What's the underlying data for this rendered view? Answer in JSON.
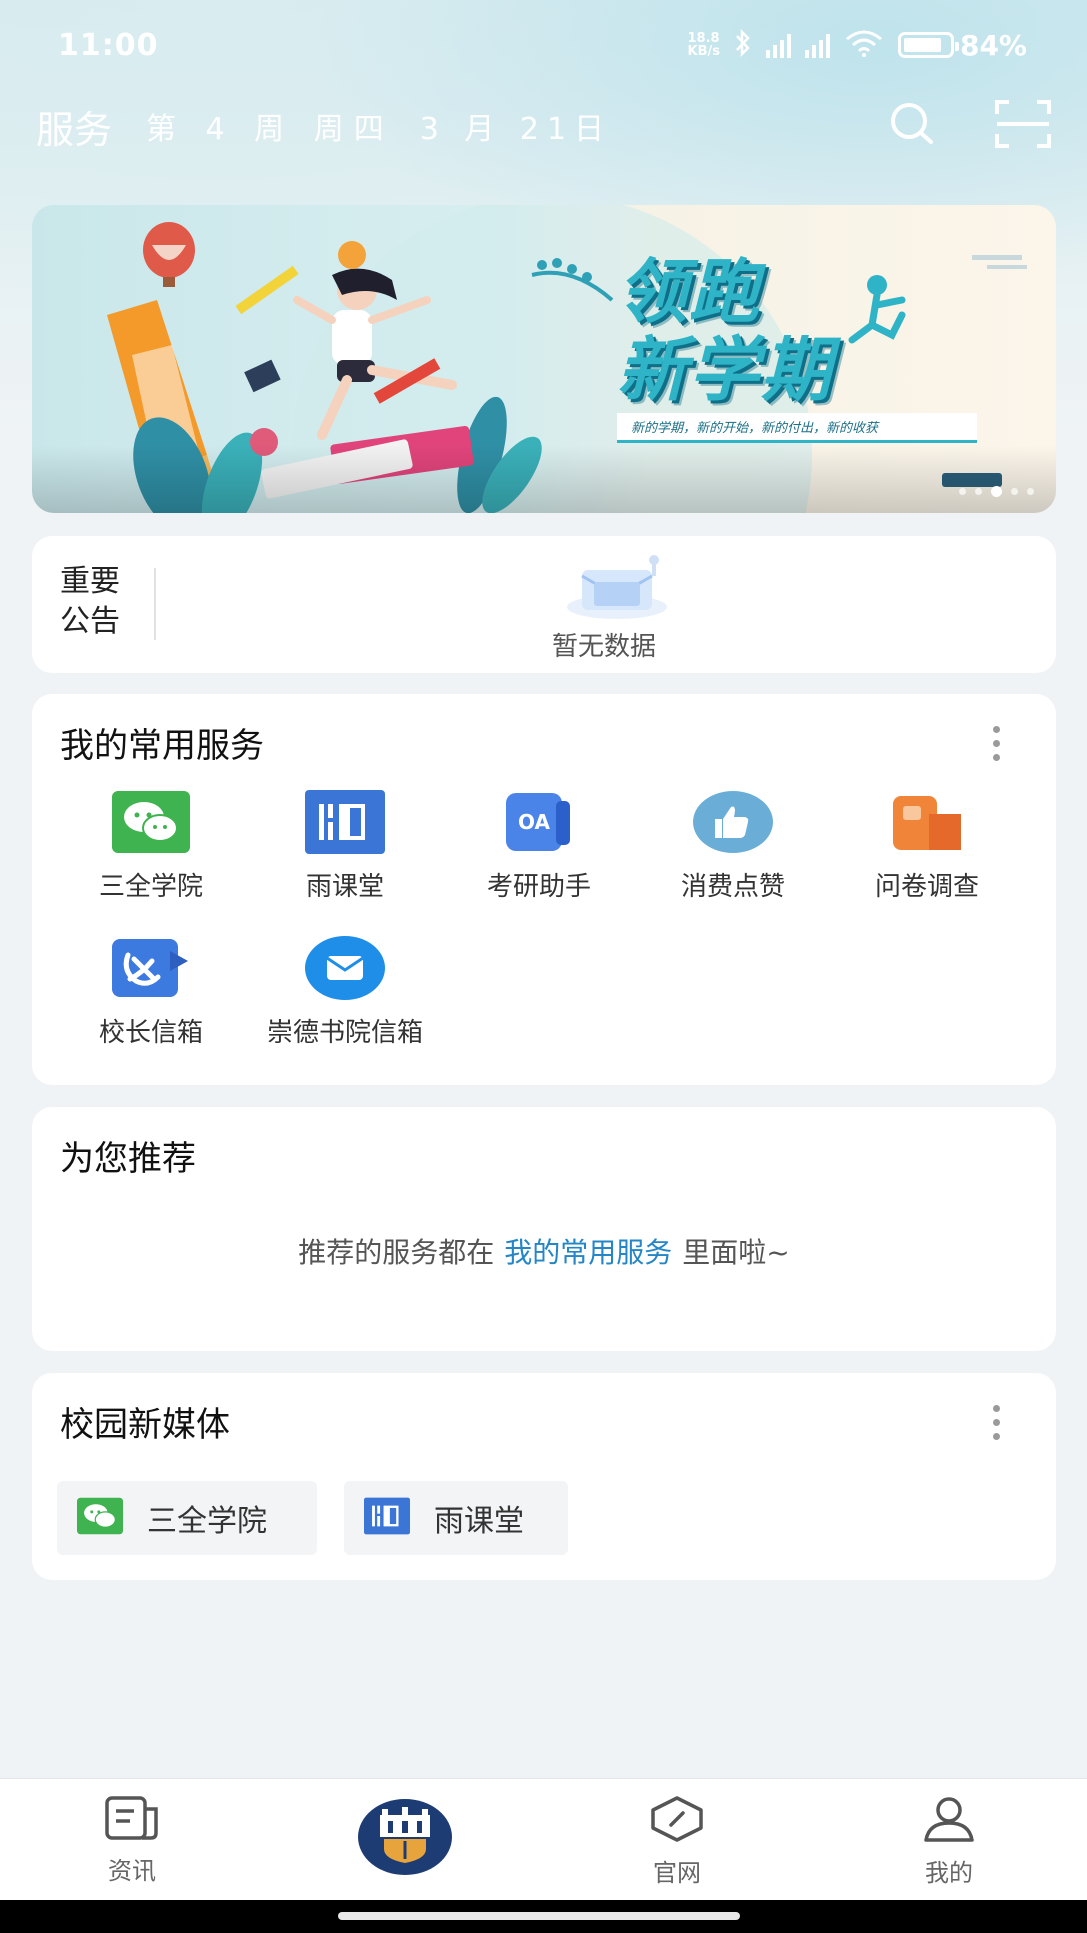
{
  "status_bar": {
    "time": "11:00",
    "net_speed_value": "18.8",
    "net_speed_unit": "KB/s",
    "battery_percent": "84%",
    "battery_level": 0.84
  },
  "header": {
    "title": "服务",
    "week": "第 4 周 周四",
    "date": "3 月 21日"
  },
  "banner": {
    "title_line1": "领跑",
    "title_line2": "新学期",
    "subtitle": "新的学期，新的开始，新的付出，新的收获",
    "slide_count": 5,
    "active_slide": 3
  },
  "notice": {
    "label_line1": "重要",
    "label_line2": "公告",
    "empty_text": "暂无数据"
  },
  "services": {
    "title": "我的常用服务",
    "items": [
      {
        "label": "三全学院",
        "icon": "wechat-icon"
      },
      {
        "label": "雨课堂",
        "icon": "rain-classroom-icon"
      },
      {
        "label": "考研助手",
        "icon": "oa-icon"
      },
      {
        "label": "消费点赞",
        "icon": "thumbs-up-icon"
      },
      {
        "label": "问卷调查",
        "icon": "questionnaire-icon"
      },
      {
        "label": "校长信箱",
        "icon": "party-emblem-icon"
      },
      {
        "label": "崇德书院信箱",
        "icon": "mail-icon"
      }
    ]
  },
  "recommend": {
    "title": "为您推荐",
    "text_before": "推荐的服务都在",
    "link_text": "我的常用服务",
    "text_after": "里面啦~"
  },
  "media": {
    "title": "校园新媒体",
    "items": [
      {
        "label": "三全学院",
        "icon": "wechat-icon"
      },
      {
        "label": "雨课堂",
        "icon": "rain-classroom-icon"
      }
    ]
  },
  "bottom_nav": {
    "items": [
      {
        "label": "资讯",
        "icon": "news-icon"
      },
      {
        "label": "",
        "icon": "school-emblem-icon"
      },
      {
        "label": "官网",
        "icon": "compass-icon"
      },
      {
        "label": "我的",
        "icon": "user-icon"
      }
    ]
  }
}
